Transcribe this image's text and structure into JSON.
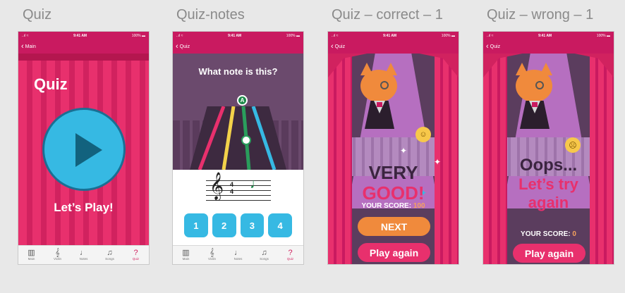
{
  "boards": [
    {
      "label": "Quiz"
    },
    {
      "label": "Quiz-notes"
    },
    {
      "label": "Quiz – correct – 1"
    },
    {
      "label": "Quiz – wrong – 1"
    }
  ],
  "status": {
    "time": "9:41 AM",
    "battery": "100%",
    "signal": "..ıl ≈"
  },
  "tabs": [
    {
      "label": "Main",
      "icon": "▥"
    },
    {
      "label": "Violin",
      "icon": "𝄞"
    },
    {
      "label": "Notes",
      "icon": "♩"
    },
    {
      "label": "Songs",
      "icon": "♫"
    },
    {
      "label": "Quiz",
      "icon": "?"
    }
  ],
  "screen_quiz": {
    "back_label": "Main",
    "title": "Quiz",
    "cta": "Let’s Play!"
  },
  "screen_notes": {
    "back_label": "Quiz",
    "question": "What note is this?",
    "note_badge": "A",
    "time_sig_top": "4",
    "time_sig_bottom": "4",
    "answers": [
      "1",
      "2",
      "3",
      "4"
    ]
  },
  "screen_correct": {
    "back_label": "Quiz",
    "headline_1": "VERY",
    "headline_2": "GOOD!",
    "score_label": "YOUR SCORE:",
    "score_value": "100",
    "next_label": "NEXT",
    "again_label": "Play again"
  },
  "screen_wrong": {
    "back_label": "Quiz",
    "headline_1": "Oops...",
    "headline_2": "Let’s try",
    "headline_3": "again",
    "score_label": "YOUR SCORE:",
    "score_value": "0",
    "again_label": "Play again"
  },
  "colors": {
    "brand_magenta": "#c91a60",
    "curtain": "#e8306d",
    "play_blue": "#36b9e3",
    "next_orange": "#f08a3c",
    "highlight_pink": "#e8306d"
  }
}
